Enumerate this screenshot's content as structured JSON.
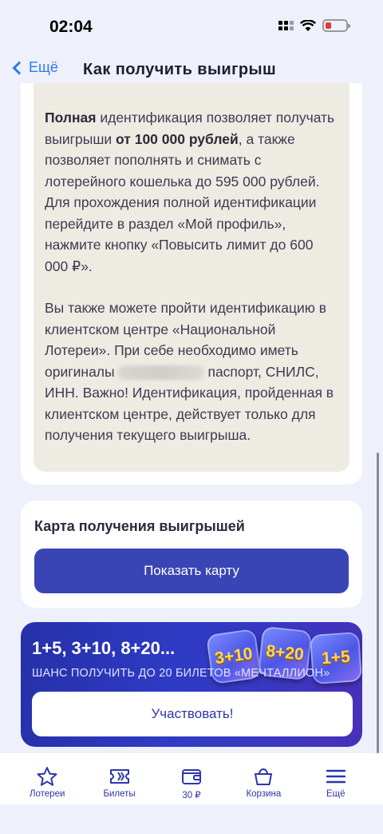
{
  "status": {
    "time": "02:04"
  },
  "nav": {
    "back_label": "Ещё",
    "title": "Как получить выигрыш"
  },
  "info": {
    "p1_bold_1": "Полная",
    "p1_text_1": " идентификация позволяет получать выигрыши ",
    "p1_bold_2": "от 100 000 рублей",
    "p1_text_2": ", а также позволяет пополнять и снимать с лотерейного кошелька до 595 000 рублей. Для прохождения полной идентификации перейдите в раздел «Мой профиль», нажмите кнопку «Повысить лимит до 600 000 ₽».",
    "p2_text_1": "Вы также можете пройти идентификацию в клиентском центре «Национальной Лотереи». При себе необходимо иметь оригиналы",
    "p2_text_2": "паспорт, СНИЛС, ИНН. Важно! Идентификация, пройденная в клиентском центре, действует только для получения текущего выигрыша."
  },
  "map_card": {
    "title": "Карта получения выигрышей",
    "button_label": "Показать карту"
  },
  "promo": {
    "title": "1+5, 3+10, 8+20...",
    "subtitle": "ШАНС ПОЛУЧИТЬ ДО 20 БИЛЕТОВ «МЕЧТАЛЛИОН»",
    "button_label": "Участвовать!",
    "tiles": [
      "3+10",
      "8+20",
      "1+5"
    ]
  },
  "tabs": [
    {
      "label": "Лотереи",
      "icon": "star-icon"
    },
    {
      "label": "Билеты",
      "icon": "ticket-icon"
    },
    {
      "label": "30 ₽",
      "icon": "wallet-icon"
    },
    {
      "label": "Корзина",
      "icon": "basket-icon"
    },
    {
      "label": "Ещё",
      "icon": "menu-icon"
    }
  ],
  "colors": {
    "accent": "#3a45b5",
    "link": "#2b7de9",
    "info_bg": "#eeebe3",
    "page_bg": "#eef0fb"
  }
}
